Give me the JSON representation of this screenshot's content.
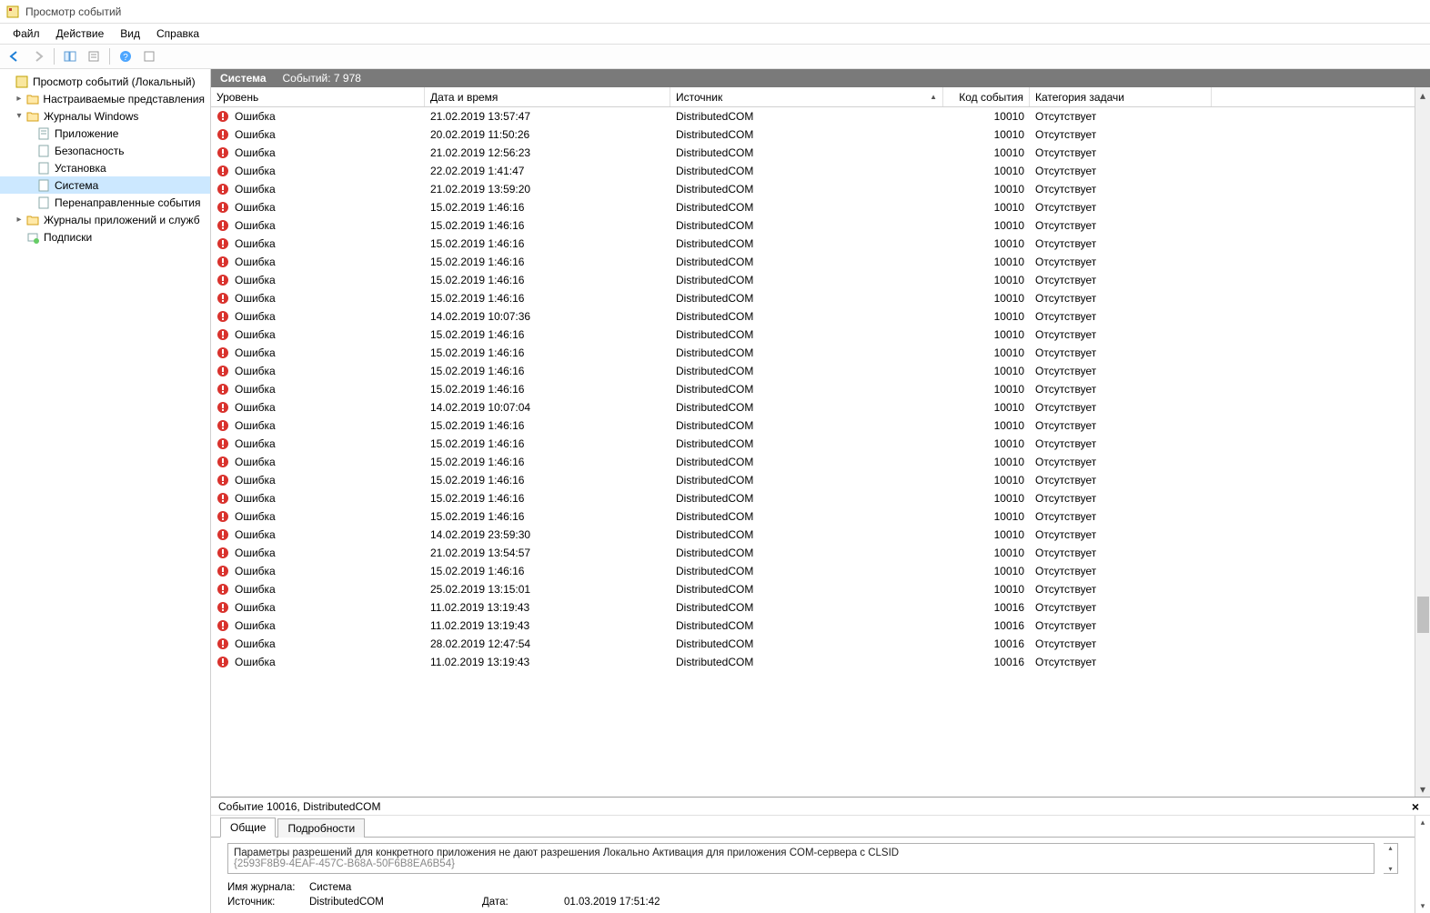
{
  "window": {
    "title": "Просмотр событий"
  },
  "menu": [
    "Файл",
    "Действие",
    "Вид",
    "Справка"
  ],
  "tree": {
    "root": "Просмотр событий (Локальный)",
    "custom_views": "Настраиваемые представления",
    "win_logs": "Журналы Windows",
    "app": "Приложение",
    "security": "Безопасность",
    "setup": "Установка",
    "system": "Система",
    "forwarded": "Перенаправленные события",
    "app_logs": "Журналы приложений и служб",
    "subs": "Подписки"
  },
  "header": {
    "title": "Система",
    "count_label": "Событий: 7 978"
  },
  "columns": {
    "level": "Уровень",
    "date": "Дата и время",
    "source": "Источник",
    "eventid": "Код события",
    "task": "Категория задачи"
  },
  "level_error": "Ошибка",
  "events": [
    {
      "date": "21.02.2019 13:57:47",
      "source": "DistributedCOM",
      "id": "10010",
      "task": "Отсутствует"
    },
    {
      "date": "20.02.2019 11:50:26",
      "source": "DistributedCOM",
      "id": "10010",
      "task": "Отсутствует"
    },
    {
      "date": "21.02.2019 12:56:23",
      "source": "DistributedCOM",
      "id": "10010",
      "task": "Отсутствует"
    },
    {
      "date": "22.02.2019 1:41:47",
      "source": "DistributedCOM",
      "id": "10010",
      "task": "Отсутствует"
    },
    {
      "date": "21.02.2019 13:59:20",
      "source": "DistributedCOM",
      "id": "10010",
      "task": "Отсутствует"
    },
    {
      "date": "15.02.2019 1:46:16",
      "source": "DistributedCOM",
      "id": "10010",
      "task": "Отсутствует"
    },
    {
      "date": "15.02.2019 1:46:16",
      "source": "DistributedCOM",
      "id": "10010",
      "task": "Отсутствует"
    },
    {
      "date": "15.02.2019 1:46:16",
      "source": "DistributedCOM",
      "id": "10010",
      "task": "Отсутствует"
    },
    {
      "date": "15.02.2019 1:46:16",
      "source": "DistributedCOM",
      "id": "10010",
      "task": "Отсутствует"
    },
    {
      "date": "15.02.2019 1:46:16",
      "source": "DistributedCOM",
      "id": "10010",
      "task": "Отсутствует"
    },
    {
      "date": "15.02.2019 1:46:16",
      "source": "DistributedCOM",
      "id": "10010",
      "task": "Отсутствует"
    },
    {
      "date": "14.02.2019 10:07:36",
      "source": "DistributedCOM",
      "id": "10010",
      "task": "Отсутствует"
    },
    {
      "date": "15.02.2019 1:46:16",
      "source": "DistributedCOM",
      "id": "10010",
      "task": "Отсутствует"
    },
    {
      "date": "15.02.2019 1:46:16",
      "source": "DistributedCOM",
      "id": "10010",
      "task": "Отсутствует"
    },
    {
      "date": "15.02.2019 1:46:16",
      "source": "DistributedCOM",
      "id": "10010",
      "task": "Отсутствует"
    },
    {
      "date": "15.02.2019 1:46:16",
      "source": "DistributedCOM",
      "id": "10010",
      "task": "Отсутствует"
    },
    {
      "date": "14.02.2019 10:07:04",
      "source": "DistributedCOM",
      "id": "10010",
      "task": "Отсутствует"
    },
    {
      "date": "15.02.2019 1:46:16",
      "source": "DistributedCOM",
      "id": "10010",
      "task": "Отсутствует"
    },
    {
      "date": "15.02.2019 1:46:16",
      "source": "DistributedCOM",
      "id": "10010",
      "task": "Отсутствует"
    },
    {
      "date": "15.02.2019 1:46:16",
      "source": "DistributedCOM",
      "id": "10010",
      "task": "Отсутствует"
    },
    {
      "date": "15.02.2019 1:46:16",
      "source": "DistributedCOM",
      "id": "10010",
      "task": "Отсутствует"
    },
    {
      "date": "15.02.2019 1:46:16",
      "source": "DistributedCOM",
      "id": "10010",
      "task": "Отсутствует"
    },
    {
      "date": "15.02.2019 1:46:16",
      "source": "DistributedCOM",
      "id": "10010",
      "task": "Отсутствует"
    },
    {
      "date": "14.02.2019 23:59:30",
      "source": "DistributedCOM",
      "id": "10010",
      "task": "Отсутствует"
    },
    {
      "date": "21.02.2019 13:54:57",
      "source": "DistributedCOM",
      "id": "10010",
      "task": "Отсутствует"
    },
    {
      "date": "15.02.2019 1:46:16",
      "source": "DistributedCOM",
      "id": "10010",
      "task": "Отсутствует"
    },
    {
      "date": "25.02.2019 13:15:01",
      "source": "DistributedCOM",
      "id": "10010",
      "task": "Отсутствует"
    },
    {
      "date": "11.02.2019 13:19:43",
      "source": "DistributedCOM",
      "id": "10016",
      "task": "Отсутствует"
    },
    {
      "date": "11.02.2019 13:19:43",
      "source": "DistributedCOM",
      "id": "10016",
      "task": "Отсутствует"
    },
    {
      "date": "28.02.2019 12:47:54",
      "source": "DistributedCOM",
      "id": "10016",
      "task": "Отсутствует"
    },
    {
      "date": "11.02.2019 13:19:43",
      "source": "DistributedCOM",
      "id": "10016",
      "task": "Отсутствует"
    }
  ],
  "detail": {
    "title": "Событие 10016, DistributedCOM",
    "tab_general": "Общие",
    "tab_details": "Подробности",
    "description": "Параметры разрешений для конкретного приложения не дают разрешения Локально Активация для приложения COM-сервера с CLSID",
    "clsid_line": "{2593F8B9-4EAF-457C-B68A-50F6B8EA6B54}",
    "log_name_label": "Имя журнала:",
    "log_name_value": "Система",
    "source_label": "Источник:",
    "source_value": "DistributedCOM",
    "date_label": "Дата:",
    "date_value": "01.03.2019 17:51:42"
  }
}
